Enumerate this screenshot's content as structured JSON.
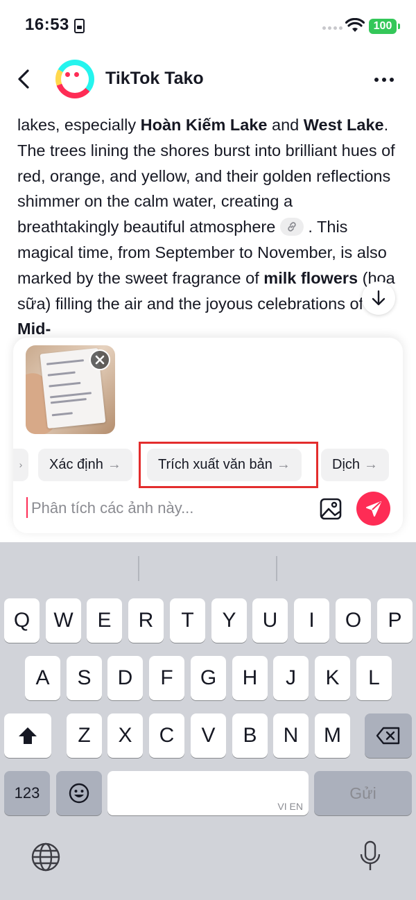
{
  "status_bar": {
    "time": "16:53",
    "battery": "100"
  },
  "header": {
    "title": "TikTok Tako"
  },
  "message": {
    "segments": [
      {
        "t": "lakes, especially ",
        "b": false
      },
      {
        "t": "Hoàn Kiếm Lake",
        "b": true
      },
      {
        "t": " and ",
        "b": false
      },
      {
        "t": "West Lake",
        "b": true
      },
      {
        "t": ". The trees lining the shores burst into brilliant hues of red, orange, and yellow, and their golden reflections shimmer on the calm water, creating a breathtakingly beautiful atmosphere ",
        "b": false
      },
      {
        "t": "[link]",
        "b": false
      },
      {
        "t": " . This magical time, from September to November, is also marked by the sweet fragrance of ",
        "b": false
      },
      {
        "t": "milk flowers",
        "b": true
      },
      {
        "t": " (hoa sữa) filling the air and the joyous celebrations of the ",
        "b": false
      },
      {
        "t": "Mid-",
        "b": true
      }
    ]
  },
  "composer": {
    "suggestions": [
      {
        "label": "Xác định",
        "arrow": "→"
      },
      {
        "label": "Trích xuất văn bản",
        "arrow": "→"
      },
      {
        "label": "Dịch",
        "arrow": "→"
      }
    ],
    "previous_chip_arrow": "›",
    "input_placeholder": "Phân tích các ảnh này...",
    "input_value": ""
  },
  "keyboard": {
    "row1": [
      "Q",
      "W",
      "E",
      "R",
      "T",
      "Y",
      "U",
      "I",
      "O",
      "P"
    ],
    "row2": [
      "A",
      "S",
      "D",
      "F",
      "G",
      "H",
      "J",
      "K",
      "L"
    ],
    "row3": [
      "Z",
      "X",
      "C",
      "V",
      "B",
      "N",
      "M"
    ],
    "numbers_key": "123",
    "send_key": "Gửi",
    "space_hint": "VI EN"
  },
  "icons": {
    "back": "chevron-left-icon",
    "more": "more-horizontal-icon",
    "link": "link-icon",
    "scroll_down": "arrow-down-icon",
    "close": "close-icon",
    "image": "image-icon",
    "send": "send-icon",
    "shift": "shift-icon",
    "backspace": "backspace-icon",
    "emoji": "emoji-icon",
    "globe": "globe-icon",
    "mic": "microphone-icon"
  },
  "colors": {
    "accent": "#fe2c55",
    "highlight": "#e32d2d",
    "battery": "#34c759",
    "keyboard_bg": "#d1d3d9"
  }
}
